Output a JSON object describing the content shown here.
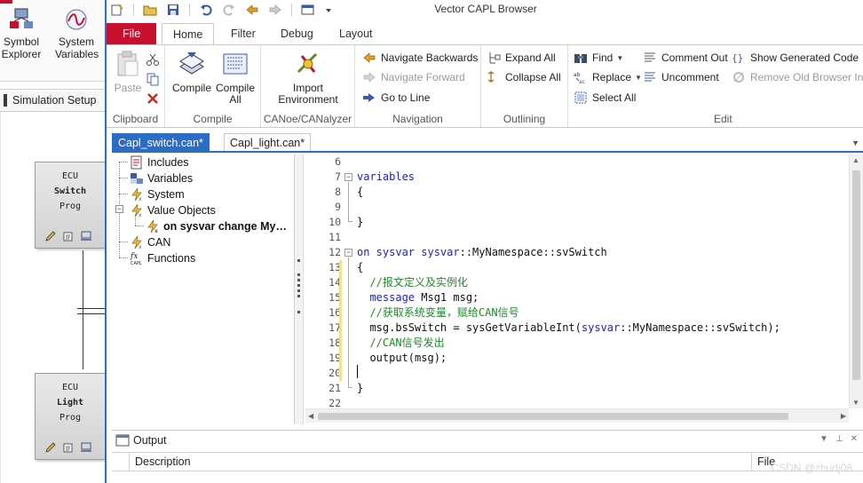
{
  "background_app": {
    "buttons": [
      {
        "line1": "Symbol",
        "line2": "Explorer",
        "icon": "symbol-explorer-icon"
      },
      {
        "line1": "System",
        "line2": "Variables",
        "icon": "system-variables-icon"
      }
    ],
    "simulation_tab": "Simulation Setup",
    "ecus": [
      {
        "type": "ECU",
        "name": "Switch",
        "sub": "Prog"
      },
      {
        "type": "ECU",
        "name": "Light",
        "sub": "Prog"
      }
    ]
  },
  "window": {
    "title": "Vector CAPL Browser"
  },
  "ribbon_tabs": [
    "File",
    "Home",
    "Filter",
    "Debug",
    "Layout"
  ],
  "ribbon": {
    "clipboard": {
      "label": "Clipboard",
      "paste": "Paste"
    },
    "compile": {
      "label": "Compile",
      "compile": "Compile",
      "compile_all_1": "Compile",
      "compile_all_2": "All"
    },
    "canoe": {
      "label": "CANoe/CANalyzer",
      "import_1": "Import",
      "import_2": "Environment"
    },
    "navigation": {
      "label": "Navigation",
      "back": "Navigate Backwards",
      "forward": "Navigate Forward",
      "goto": "Go to Line"
    },
    "outlining": {
      "label": "Outlining",
      "expand": "Expand All",
      "collapse": "Collapse All"
    },
    "edit": {
      "label": "Edit",
      "find": "Find",
      "replace": "Replace",
      "select_all": "Select All",
      "comment": "Comment Out",
      "uncomment": "Uncomment",
      "show_gen": "Show Generated Code",
      "remove_old": "Remove Old Browser Info"
    }
  },
  "doc_tabs": [
    "Capl_switch.can*",
    "Capl_light.can*"
  ],
  "tree": {
    "items": [
      {
        "label": "Includes",
        "icon": "includes-icon"
      },
      {
        "label": "Variables",
        "icon": "variables-icon"
      },
      {
        "label": "System",
        "icon": "system-event-icon"
      },
      {
        "label": "Value Objects",
        "icon": "value-objects-icon"
      },
      {
        "label": "on sysvar change My…",
        "icon": "sysvar-handler-icon"
      },
      {
        "label": "CAN",
        "icon": "can-icon"
      },
      {
        "label": "Functions",
        "icon": "functions-icon"
      }
    ]
  },
  "editor": {
    "line_numbers": [
      "6",
      "7",
      "8",
      "9",
      "10",
      "11",
      "12",
      "13",
      "14",
      "15",
      "16",
      "17",
      "18",
      "19",
      "20",
      "21",
      "22"
    ],
    "lines": [
      {
        "n": "6",
        "tokens": []
      },
      {
        "n": "7",
        "tokens": [
          {
            "t": "variables",
            "c": "kw"
          }
        ]
      },
      {
        "n": "8",
        "tokens": [
          {
            "t": "{",
            "c": ""
          }
        ]
      },
      {
        "n": "9",
        "tokens": []
      },
      {
        "n": "10",
        "tokens": [
          {
            "t": "}",
            "c": ""
          }
        ]
      },
      {
        "n": "11",
        "tokens": []
      },
      {
        "n": "12",
        "tokens": [
          {
            "t": "on sysvar sysvar",
            "c": "kw"
          },
          {
            "t": "::MyNamespace::svSwitch",
            "c": ""
          }
        ]
      },
      {
        "n": "13",
        "tokens": [
          {
            "t": "{",
            "c": ""
          }
        ]
      },
      {
        "n": "14",
        "tokens": [
          {
            "t": "  //报文定义及实例化",
            "c": "cm"
          }
        ]
      },
      {
        "n": "15",
        "tokens": [
          {
            "t": "  ",
            "c": ""
          },
          {
            "t": "message",
            "c": "kw"
          },
          {
            "t": " Msg1 msg;",
            "c": ""
          }
        ]
      },
      {
        "n": "16",
        "tokens": [
          {
            "t": "  //获取系统变量，赋给CAN信号",
            "c": "cm"
          }
        ]
      },
      {
        "n": "17",
        "tokens": [
          {
            "t": "  msg.bsSwitch = sysGetVariableInt(",
            "c": ""
          },
          {
            "t": "sysvar",
            "c": "kw"
          },
          {
            "t": "::MyNamespace::svSwitch);",
            "c": ""
          }
        ]
      },
      {
        "n": "18",
        "tokens": [
          {
            "t": "  //CAN信号发出",
            "c": "cm"
          }
        ]
      },
      {
        "n": "19",
        "tokens": [
          {
            "t": "  output(msg);",
            "c": ""
          }
        ]
      },
      {
        "n": "20",
        "tokens": []
      },
      {
        "n": "21",
        "tokens": [
          {
            "t": "}",
            "c": ""
          }
        ]
      },
      {
        "n": "22",
        "tokens": []
      }
    ]
  },
  "output": {
    "title": "Output",
    "col_description": "Description",
    "col_file": "File",
    "watermark": "CSDN @zhudj08"
  }
}
